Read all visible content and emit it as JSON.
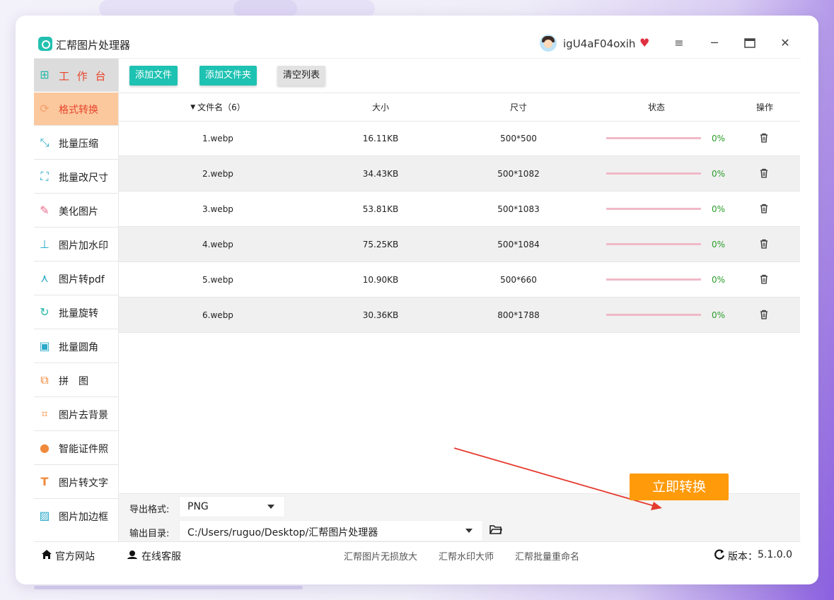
{
  "app": {
    "title": "汇帮图片处理器",
    "username": "igU4aF04oxih"
  },
  "sidebar": {
    "items": [
      {
        "label": "工 作 台",
        "icon": "grid-icon"
      },
      {
        "label": "格式转换",
        "icon": "format-convert-icon"
      },
      {
        "label": "批量压缩",
        "icon": "compress-icon"
      },
      {
        "label": "批量改尺寸",
        "icon": "resize-icon"
      },
      {
        "label": "美化图片",
        "icon": "beautify-icon"
      },
      {
        "label": "图片加水印",
        "icon": "watermark-icon"
      },
      {
        "label": "图片转pdf",
        "icon": "pdf-icon"
      },
      {
        "label": "批量旋转",
        "icon": "rotate-icon"
      },
      {
        "label": "批量圆角",
        "icon": "round-corner-icon"
      },
      {
        "label": "拼　图",
        "icon": "collage-icon"
      },
      {
        "label": "图片去背景",
        "icon": "crop-icon"
      },
      {
        "label": "智能证件照",
        "icon": "person-icon"
      },
      {
        "label": "图片转文字",
        "icon": "text-icon"
      },
      {
        "label": "图片加边框",
        "icon": "frame-icon"
      }
    ]
  },
  "toolbar": {
    "add_file": "添加文件",
    "add_folder": "添加文件夹",
    "clear_list": "清空列表"
  },
  "table": {
    "headers": {
      "name": "文件名（6）",
      "size": "大小",
      "dimensions": "尺寸",
      "status": "状态",
      "actions": "操作"
    },
    "rows": [
      {
        "name": "1.webp",
        "size": "16.11KB",
        "dim": "500*500",
        "progress": "0%"
      },
      {
        "name": "2.webp",
        "size": "34.43KB",
        "dim": "500*1082",
        "progress": "0%"
      },
      {
        "name": "3.webp",
        "size": "53.81KB",
        "dim": "500*1083",
        "progress": "0%"
      },
      {
        "name": "4.webp",
        "size": "75.25KB",
        "dim": "500*1084",
        "progress": "0%"
      },
      {
        "name": "5.webp",
        "size": "10.90KB",
        "dim": "500*660",
        "progress": "0%"
      },
      {
        "name": "6.webp",
        "size": "30.36KB",
        "dim": "800*1788",
        "progress": "0%"
      }
    ]
  },
  "output": {
    "format_label": "导出格式:",
    "format_value": "PNG",
    "dir_label": "输出目录:",
    "dir_value": "C:/Users/ruguo/Desktop/汇帮图片处理器",
    "convert_button": "立即转换"
  },
  "footer": {
    "website": "官方网站",
    "support": "在线客服",
    "links": [
      "汇帮图片无损放大",
      "汇帮水印大师",
      "汇帮批量重命名"
    ],
    "version_label": "版本：",
    "version": "5.1.0.0"
  },
  "colors": {
    "accent": "#1ec2b2",
    "active_bg": "#fbc89e",
    "active_text": "#e8452c",
    "convert": "#ff9a0a",
    "progress_text": "#2a9d2a"
  }
}
